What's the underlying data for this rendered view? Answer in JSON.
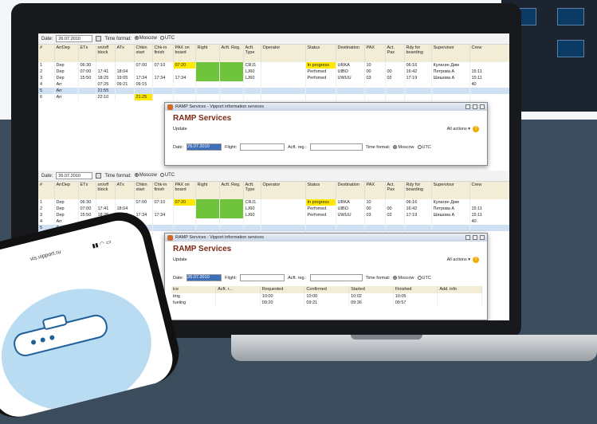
{
  "toolbar": {
    "date_label": "Date:",
    "date_value": "26.07.2010",
    "time_format_label": "Time format:",
    "moscow": "Moscow",
    "utc": "UTC"
  },
  "columns": [
    "#",
    "ArrDep",
    "ETx",
    "on/off block",
    "ATx",
    "Chkin start",
    "Chk-in finish",
    "PAX on board",
    "Right",
    "Acft. Reg.",
    "Acft. Type",
    "Operator",
    "Status",
    "Destination",
    "PAX",
    "Act. Pax",
    "Rdy for boarding",
    "Supervisor",
    "Crew"
  ],
  "rows": [
    [
      "1",
      "Dep",
      "06:30",
      "",
      "",
      "07:00",
      "07:10",
      "07:20",
      "",
      "",
      "CRJ1",
      "",
      "In progress",
      "URKA",
      "10",
      "",
      "06:16",
      "Кулагин Дим",
      ""
    ],
    [
      "2",
      "Dep",
      "07:00",
      "17:41",
      "18:04",
      "",
      "",
      "",
      "",
      "",
      "LJ60",
      "",
      "Perfomed",
      "UIBO",
      "00",
      "00",
      "16:42",
      "Петрова А",
      "15:11"
    ],
    [
      "3",
      "Dep",
      "15:50",
      "18:25",
      "19:05",
      "17:34",
      "17:34",
      "17:34",
      "",
      "",
      "LJ60",
      "",
      "Perfomed",
      "UWUU",
      "03",
      "02",
      "17:19",
      "Шишова А",
      "15:11"
    ],
    [
      "4",
      "Arr",
      "",
      "07:25",
      "09:21",
      "09:15",
      "",
      "",
      "",
      "",
      "",
      "",
      "",
      "",
      "",
      "",
      "",
      "",
      "40"
    ],
    [
      "5",
      "Arr",
      "",
      "21:55",
      "",
      "",
      "",
      "",
      "",
      "",
      "",
      "",
      "",
      "",
      "",
      "",
      "",
      "",
      ""
    ],
    [
      "6",
      "Arr",
      "",
      "22:10",
      "",
      "21:25",
      "",
      "",
      "",
      "",
      "",
      "",
      "",
      "",
      "",
      "",
      "",
      "",
      ""
    ]
  ],
  "dialog": {
    "title": "RAMP Services - Vipport information services",
    "heading": "RAMP Services",
    "update": "Update",
    "all_actions": "All actions ▾",
    "date_label": "Date:",
    "date_value": "26.07.2010",
    "flight_label": "Flight:",
    "reg_label": "Acft. reg.:",
    "time_format_label": "Time format:",
    "moscow": "Moscow",
    "utc": "UTC"
  },
  "dialog_table": {
    "columns": [
      "ice",
      "Acft. r...",
      "Requested",
      "Confirmed",
      "Started",
      "Finished",
      "Add. info"
    ],
    "rows": [
      [
        "ting",
        "",
        "10:00",
        "10:00",
        "10:02",
        "10:05",
        ""
      ],
      [
        "fueling",
        "",
        "09:20",
        "09:21",
        "09:36",
        "09:57",
        ""
      ]
    ]
  },
  "phone": {
    "url": "vis.vipport.ru"
  }
}
